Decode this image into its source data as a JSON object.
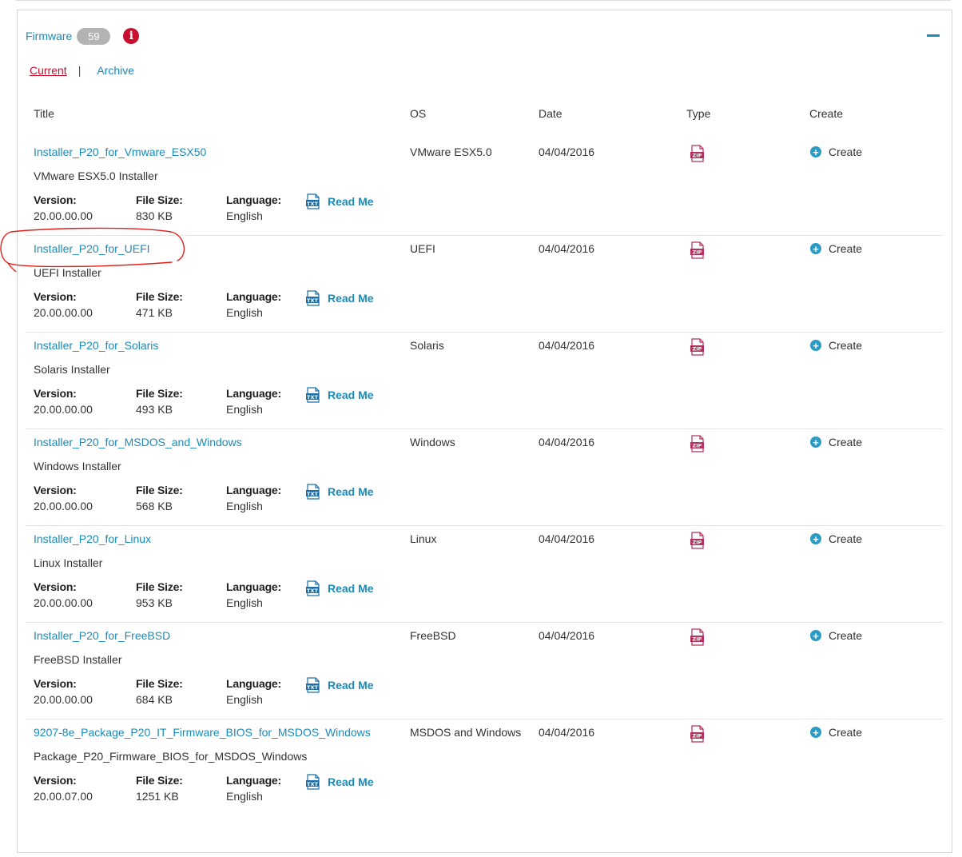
{
  "panel": {
    "title": "Firmware",
    "count": "59",
    "info_icon": "info-icon",
    "collapse_icon": "minus-icon"
  },
  "tabs": {
    "current": "Current",
    "separator": "|",
    "archive": "Archive"
  },
  "columns": {
    "title": "Title",
    "os": "OS",
    "date": "Date",
    "type": "Type",
    "create": "Create"
  },
  "labels": {
    "version": "Version:",
    "file_size": "File Size:",
    "language": "Language:",
    "read_me": "Read Me",
    "create": "Create",
    "zip": "ZIP",
    "txt": "TXT"
  },
  "colors": {
    "accent": "#1a8bb9",
    "red": "#c8102e",
    "zip": "#b5305a"
  },
  "rows": [
    {
      "title": "Installer_P20_for_Vmware_ESX50",
      "description": "VMware ESX5.0 Installer",
      "os": "VMware ESX5.0",
      "date": "04/04/2016",
      "version": "20.00.00.00",
      "file_size": "830 KB",
      "language": "English"
    },
    {
      "title": "Installer_P20_for_UEFI",
      "description": "UEFI Installer",
      "os": "UEFI",
      "date": "04/04/2016",
      "version": "20.00.00.00",
      "file_size": "471 KB",
      "language": "English"
    },
    {
      "title": "Installer_P20_for_Solaris",
      "description": "Solaris Installer",
      "os": "Solaris",
      "date": "04/04/2016",
      "version": "20.00.00.00",
      "file_size": "493 KB",
      "language": "English"
    },
    {
      "title": "Installer_P20_for_MSDOS_and_Windows",
      "description": "Windows Installer",
      "os": "Windows",
      "date": "04/04/2016",
      "version": "20.00.00.00",
      "file_size": "568 KB",
      "language": "English"
    },
    {
      "title": "Installer_P20_for_Linux",
      "description": "Linux Installer",
      "os": "Linux",
      "date": "04/04/2016",
      "version": "20.00.00.00",
      "file_size": "953 KB",
      "language": "English"
    },
    {
      "title": "Installer_P20_for_FreeBSD",
      "description": "FreeBSD Installer",
      "os": "FreeBSD",
      "date": "04/04/2016",
      "version": "20.00.00.00",
      "file_size": "684 KB",
      "language": "English"
    },
    {
      "title": "9207-8e_Package_P20_IT_Firmware_BIOS_for_MSDOS_Windows",
      "description": "Package_P20_Firmware_BIOS_for_MSDOS_Windows",
      "os": "MSDOS and Windows",
      "date": "04/04/2016",
      "version": "20.00.07.00",
      "file_size": "1251 KB",
      "language": "English"
    }
  ]
}
